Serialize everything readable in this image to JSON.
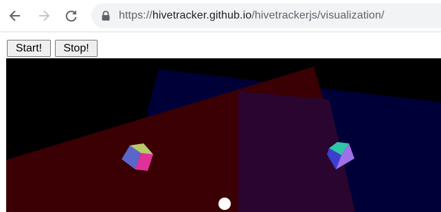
{
  "browser": {
    "url": {
      "scheme": "https://",
      "host": "hivetracker.github.io",
      "path": "/hivetrackerjs/visualization/"
    },
    "icons": {
      "back": "arrow-left-icon",
      "forward": "arrow-right-icon",
      "reload": "reload-icon",
      "lock": "lock-icon"
    }
  },
  "controls": {
    "start_label": "Start!",
    "stop_label": "Stop!"
  },
  "scene": {
    "background": "#000000",
    "colors": {
      "red_plane": "#3a0003",
      "blue_plane": "#000038",
      "overlap": "#2a0530",
      "cube_left_front": "#e0309a",
      "cube_left_side": "#5a66c9",
      "cube_right_front": "#3b3fd0",
      "cube_right_side": "#a070e8",
      "sphere": "#ffffff"
    }
  }
}
